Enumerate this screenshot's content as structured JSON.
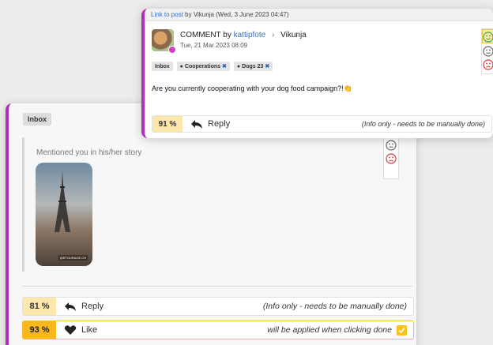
{
  "back_card": {
    "folder_tag": "Inbox",
    "story_text": "Mentioned you in his/her story",
    "story_watermark": "@ETOURAGE.CH",
    "rating_icons": [
      "neutral-face-icon",
      "sad-face-icon"
    ],
    "actions": [
      {
        "percent": "81 %",
        "icon": "reply-icon",
        "label": "Reply",
        "note": "(Info only - needs to be manually done)"
      },
      {
        "percent": "93 %",
        "icon": "heart-icon",
        "label": "Like",
        "note": "will be applied when clicking done"
      }
    ]
  },
  "front_card": {
    "header_link": "Link to post",
    "header_text": "by Vikunja (Wed, 3 June 2023 04:47)",
    "comment_prefix": "COMMENT by",
    "author": "kattipfote",
    "target": "Vikunja",
    "date": "Tue, 21 Mar 2023 08:09",
    "tags": [
      "Inbox",
      "Cooperations",
      "Dogs 23"
    ],
    "message": "Are you currently cooperating with your dog food campaign?!👏",
    "rating_icons": [
      "happy-face-icon",
      "neutral-face-icon",
      "sad-face-icon"
    ],
    "action": {
      "percent": "91 %",
      "icon": "reply-icon",
      "label": "Reply",
      "note": "(Info only - needs to be manually done)"
    }
  },
  "colors": {
    "accent": "#b72dbb",
    "percent_soft": "#fde7ad",
    "percent_strong": "#f8b61f",
    "link": "#3b6fbf"
  }
}
